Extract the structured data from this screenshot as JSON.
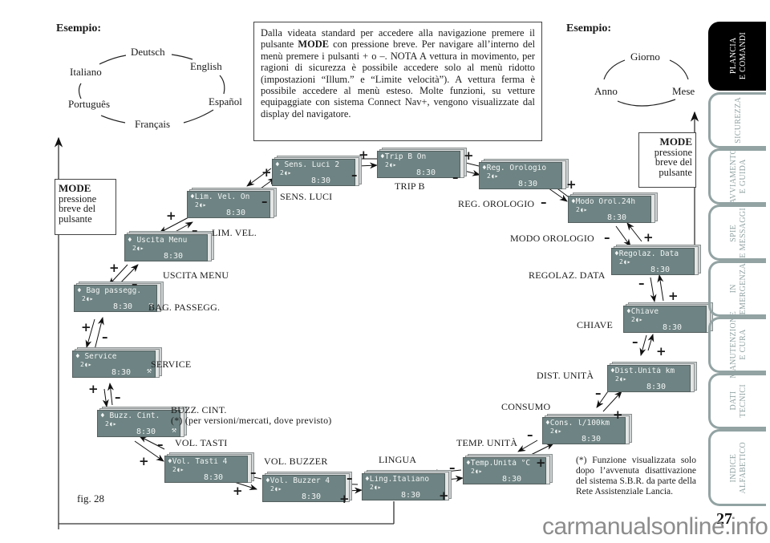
{
  "example_left": {
    "heading": "Esempio:",
    "languages": [
      "Deutsch",
      "English",
      "Español",
      "Français",
      "Português",
      "Italiano"
    ]
  },
  "example_right": {
    "heading": "Esempio:",
    "items": [
      "Giorno",
      "Mese",
      "Anno"
    ]
  },
  "info_box": {
    "text_before_mode": "Dalla videata standard per accedere alla navigazione premere il pulsante ",
    "mode": "MODE",
    "text_after_mode": " con pressione breve. Per navigare all’interno del menù premere i pulsanti + o –. NOTA A vettura in movimento, per ragioni di sicurezza è possibile accedere solo al menù ridotto (impostazioni “Illum.” e “Limite velocità”). A vettura ferma è possibile accedere al menù esteso. Molte funzioni, su vetture equipaggiate con sistema Connect Nav+, vengono visualizzate dal display del navigatore."
  },
  "mode_box_left": {
    "title": "MODE",
    "line1": "pressione",
    "line2": "breve del",
    "line3": "pulsante"
  },
  "mode_box_right": {
    "title": "MODE",
    "line1": "pressione",
    "line2": "breve del",
    "line3": "pulsante"
  },
  "displays": [
    {
      "id": "sens-luci",
      "line1": "♦ Sens. Luci 2",
      "line2": "2◖▸",
      "time": "8:30",
      "wrench": false,
      "label": "SENS. LUCI"
    },
    {
      "id": "trip-b",
      "line1": "♦Trip B     On",
      "line2": "2◖▸",
      "time": "8:30",
      "wrench": false,
      "label": "TRIP B"
    },
    {
      "id": "reg-orologio",
      "line1": "♦Reg. Orologio",
      "line2": "2◖▸",
      "time": "8:30",
      "wrench": false,
      "label": "REG. OROLOGIO"
    },
    {
      "id": "modo-orologio",
      "line1": "♦Modo Orol.24h",
      "line2": "2◖▸",
      "time": "8:30",
      "wrench": false,
      "label": "MODO OROLOGIO"
    },
    {
      "id": "regolaz-data",
      "line1": "♦Regolaz. Data",
      "line2": "2◖▸",
      "time": "8:30",
      "wrench": false,
      "label": "REGOLAZ. DATA"
    },
    {
      "id": "chiave",
      "line1": "♦Chiave",
      "line2": "2◖▸",
      "time": "8:30",
      "wrench": false,
      "label": "CHIAVE"
    },
    {
      "id": "dist-unita",
      "line1": "♦Dist.Unità km",
      "line2": "2◖▸",
      "time": "8:30",
      "wrench": false,
      "label": "DIST. UNITÀ"
    },
    {
      "id": "consumo",
      "line1": "♦Cons. l/100km",
      "line2": "2◖▸",
      "time": "8:30",
      "wrench": false,
      "label": "CONSUMO"
    },
    {
      "id": "temp-unita",
      "line1": "♦Temp.Unità °C",
      "line2": "2◖▸",
      "time": "8:30",
      "wrench": false,
      "label": "TEMP. UNITÀ"
    },
    {
      "id": "lingua",
      "line1": "♦Ling.Italiano",
      "line2": "2◖▸",
      "time": "8:30",
      "wrench": false,
      "label": "LINGUA"
    },
    {
      "id": "vol-buzzer",
      "line1": "♦Vol. Buzzer 4",
      "line2": "2◖▸",
      "time": "8:30",
      "wrench": false,
      "label": "VOL. BUZZER"
    },
    {
      "id": "vol-tasti",
      "line1": "♦Vol. Tasti  4",
      "line2": "2◖▸",
      "time": "8:30",
      "wrench": false,
      "label": "VOL. TASTI"
    },
    {
      "id": "buzz-cint",
      "line1": "♦ Buzz. Cint.",
      "line2": "2◖▸",
      "time": "8:30",
      "wrench": true,
      "label": "BUZZ. CINT."
    },
    {
      "id": "service",
      "line1": "♦   Service",
      "line2": "2◖▸",
      "time": "8:30",
      "wrench": true,
      "label": "SERVICE"
    },
    {
      "id": "bag-passegg",
      "line1": "♦ Bag passegg.",
      "line2": "2◖▸",
      "time": "8:30",
      "wrench": true,
      "label": "BAG. PASSEGG."
    },
    {
      "id": "uscita-menu",
      "line1": "♦ Uscita Menu",
      "line2": "2◖▸",
      "time": "8:30",
      "wrench": false,
      "label": "USCITA MENU"
    },
    {
      "id": "lim-vel",
      "line1": "♦Lim. Vel.  On",
      "line2": "2◖▸",
      "time": "8:30",
      "wrench": false,
      "label": "LIM. VEL."
    }
  ],
  "buzz_note": "(*) (per versioni/mercati, dove previsto)",
  "plus": "+",
  "minus": "–",
  "wrench_glyph": "⚒",
  "figure_label": "fig. 28",
  "footnote": "(*) Funzione visualizzata solo dopo l’avvenuta disattivazione del sistema S.B.R. da parte della Rete Assistenziale Lancia.",
  "page_number": "27",
  "watermark": "carmanualsonline.info",
  "side_tabs": [
    {
      "label": "PLANCIA\nE COMANDI",
      "active": true
    },
    {
      "label": "SICUREZZA",
      "active": false
    },
    {
      "label": "AVVIAMENTO\nE GUIDA",
      "active": false
    },
    {
      "label": "SPIE\nE MESSAGGI",
      "active": false
    },
    {
      "label": "IN\nEMERGENZA",
      "active": false
    },
    {
      "label": "MANUTENZIONE\nE CURA",
      "active": false
    },
    {
      "label": "DATI\nTECNICI",
      "active": false
    },
    {
      "label": "INDICE\nALFABETICO",
      "active": false
    }
  ]
}
